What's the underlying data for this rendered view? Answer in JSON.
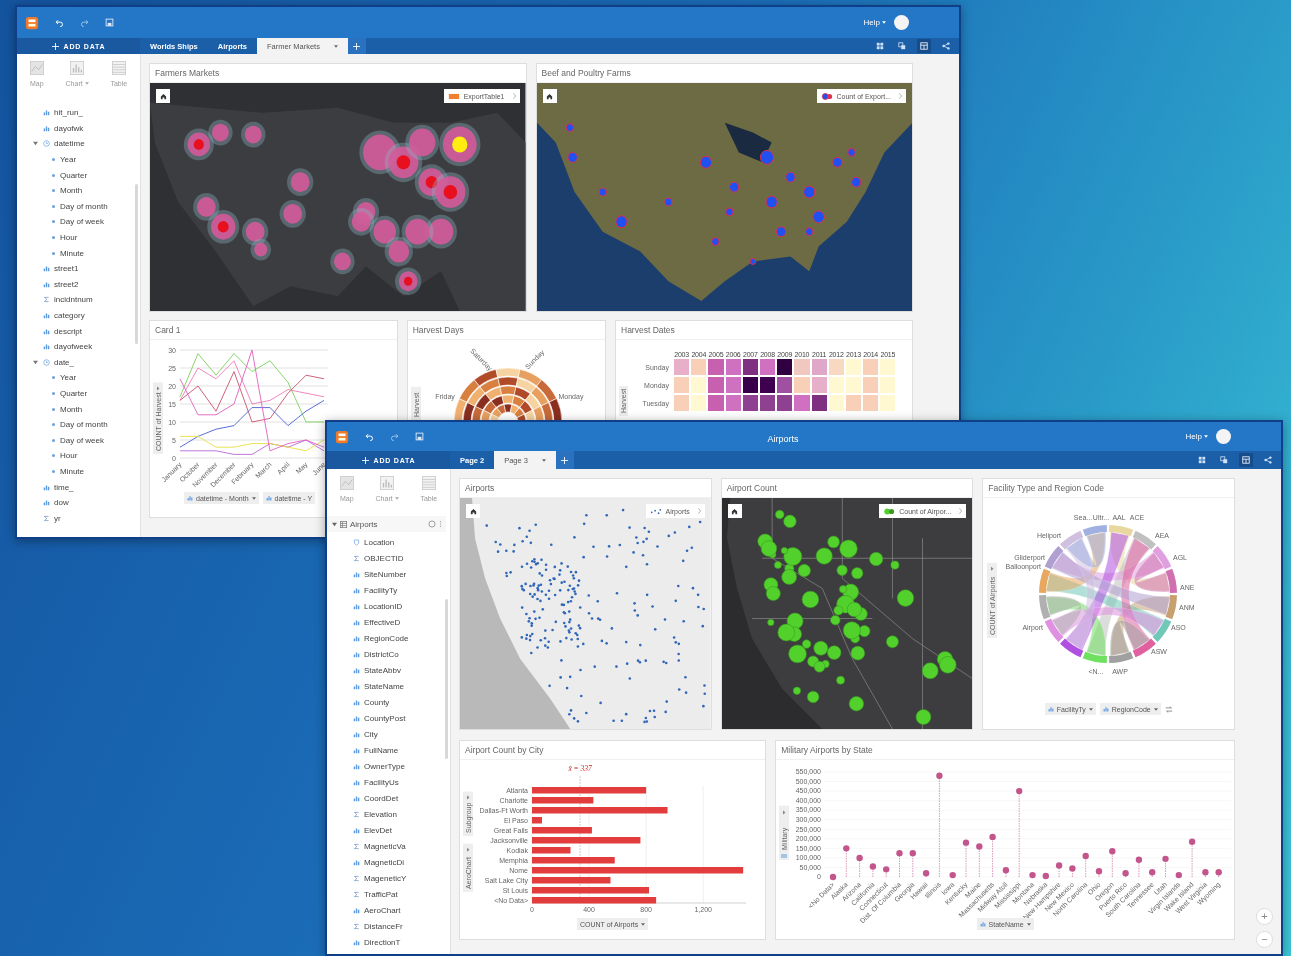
{
  "windows": [
    {
      "help": "Help",
      "add_data": "ADD DATA",
      "tabs": [
        {
          "label": "Worlds Ships",
          "selected": false
        },
        {
          "label": "Airports",
          "selected": false
        },
        {
          "label": "Farmer Markets",
          "selected": true
        }
      ],
      "create": [
        {
          "label": "Map",
          "kind": "map",
          "menu": false
        },
        {
          "label": "Chart",
          "kind": "chart",
          "menu": true
        },
        {
          "label": "Table",
          "kind": "table",
          "menu": false
        }
      ],
      "fields": [
        {
          "name": "hit_run_",
          "kind": "string"
        },
        {
          "name": "dayofwk",
          "kind": "string"
        },
        {
          "name": "datetime",
          "kind": "date",
          "expanded": true,
          "children": [
            {
              "name": "Year"
            },
            {
              "name": "Quarter"
            },
            {
              "name": "Month"
            },
            {
              "name": "Day of month"
            },
            {
              "name": "Day of week"
            },
            {
              "name": "Hour"
            },
            {
              "name": "Minute"
            }
          ]
        },
        {
          "name": "street1",
          "kind": "string"
        },
        {
          "name": "street2",
          "kind": "string"
        },
        {
          "name": "incidntnum",
          "kind": "number"
        },
        {
          "name": "category",
          "kind": "string"
        },
        {
          "name": "descript",
          "kind": "string"
        },
        {
          "name": "dayofweek",
          "kind": "string"
        },
        {
          "name": "date_",
          "kind": "date",
          "expanded": true,
          "children": [
            {
              "name": "Year"
            },
            {
              "name": "Quarter"
            },
            {
              "name": "Month"
            },
            {
              "name": "Day of month"
            },
            {
              "name": "Day of week"
            },
            {
              "name": "Hour"
            },
            {
              "name": "Minute"
            }
          ]
        },
        {
          "name": "time_",
          "kind": "string"
        },
        {
          "name": "dow",
          "kind": "string"
        },
        {
          "name": "yr",
          "kind": "number"
        }
      ],
      "card_rows": [
        [
          {
            "kind": "heat",
            "title": "Farmers Markets",
            "legend": "ExportTable1"
          },
          {
            "kind": "satellite",
            "title": "Beef and Poultry Farms",
            "legend": "Count of Export..."
          }
        ],
        [
          {
            "kind": "line",
            "title": "Card 1",
            "x_buttons": [
              {
                "label": "datetime - Month",
                "menu": true
              },
              {
                "label": "datetime - Y",
                "menu": false
              }
            ],
            "chart_data": {
              "type": "line",
              "ylabel": "COUNT of Harvest",
              "categories": [
                "January",
                "October",
                "November",
                "December",
                "February",
                "March",
                "April",
                "May",
                "June"
              ],
              "ylim": [
                0,
                30
              ],
              "yticks": [
                0,
                5,
                10,
                15,
                20,
                25,
                30
              ],
              "grid": true,
              "series": [
                {
                  "color": "#7ccf5a",
                  "values": [
                    17,
                    29,
                    23,
                    29,
                    24,
                    27,
                    21,
                    10,
                    10
                  ]
                },
                {
                  "color": "#f07ab8",
                  "values": [
                    16,
                    25,
                    22,
                    27,
                    15,
                    16,
                    19,
                    18,
                    17
                  ]
                },
                {
                  "color": "#c8506a",
                  "values": [
                    16,
                    20,
                    13,
                    24,
                    10,
                    11,
                    18,
                    23,
                    22
                  ]
                },
                {
                  "color": "#4a5fcf",
                  "values": [
                    3,
                    6,
                    8,
                    9,
                    14,
                    14,
                    9,
                    13,
                    16
                  ]
                },
                {
                  "color": "#b86ad8",
                  "values": [
                    2,
                    2,
                    2,
                    1,
                    1,
                    4,
                    3,
                    5,
                    2
                  ]
                },
                {
                  "color": "#e8e040",
                  "values": [
                    6,
                    6,
                    3,
                    3,
                    4,
                    4,
                    3,
                    2,
                    5
                  ]
                },
                {
                  "color": "#e060c0",
                  "values": [
                    22,
                    12,
                    12,
                    15,
                    30,
                    2,
                    4,
                    5,
                    3
                  ]
                }
              ]
            }
          },
          {
            "kind": "radial",
            "title": "Harvest Days",
            "axis": "Harvest",
            "labels": [
              "Saturday",
              "Sunday",
              "Friday",
              "Monday"
            ]
          },
          {
            "kind": "heatmap",
            "title": "Harvest Dates",
            "axis": "Harvest",
            "columns": [
              "2003",
              "2004",
              "2005",
              "2006",
              "2007",
              "2008",
              "2009",
              "2010",
              "2011",
              "2012",
              "2013",
              "2014",
              "2015"
            ],
            "rows": [
              {
                "label": "Sunday",
                "cells": [
                  {
                    "color": "#e8b0c8"
                  },
                  {
                    "color": "#f8d0b8"
                  },
                  {
                    "color": "#c860b0"
                  },
                  {
                    "color": "#d070c0"
                  },
                  {
                    "color": "#803080"
                  },
                  {
                    "color": "#d070c0"
                  },
                  {
                    "color": "#300040"
                  },
                  {
                    "color": "#f0c8c0"
                  },
                  {
                    "color": "#e0a8c8"
                  },
                  {
                    "color": "#f8d8c0"
                  },
                  {
                    "color": "#fff8d0"
                  },
                  {
                    "color": "#f8d0b8"
                  },
                  {
                    "color": "#fff8d0"
                  }
                ]
              },
              {
                "label": "Monday",
                "cells": [
                  {
                    "color": "#f8d0b8"
                  },
                  {
                    "color": "#fff8d0"
                  },
                  {
                    "color": "#c860b0"
                  },
                  {
                    "color": "#d070c0"
                  },
                  {
                    "color": "#380048"
                  },
                  {
                    "color": "#400050"
                  },
                  {
                    "color": "#a050a0"
                  },
                  {
                    "color": "#f8d0b8"
                  },
                  {
                    "color": "#e8b0c8"
                  },
                  {
                    "color": "#fff8d0"
                  },
                  {
                    "color": "#fff8d0"
                  },
                  {
                    "color": "#f8d0b8"
                  },
                  {
                    "color": "#fff8d0"
                  }
                ]
              },
              {
                "label": "Tuesday",
                "cells": [
                  {
                    "color": "#f8d0b8"
                  },
                  {
                    "color": "#fff8d0"
                  },
                  {
                    "color": "#c860b0"
                  },
                  {
                    "color": "#d070c0"
                  },
                  {
                    "color": "#904090"
                  },
                  {
                    "color": "#904090"
                  },
                  {
                    "color": "#904090"
                  },
                  {
                    "color": "#d070c0"
                  },
                  {
                    "color": "#803080"
                  },
                  {
                    "color": "#fff8d0"
                  },
                  {
                    "color": "#f8d0b8"
                  },
                  {
                    "color": "#f8d0b8"
                  },
                  {
                    "color": "#fff8d0"
                  }
                ]
              }
            ]
          }
        ]
      ]
    },
    {
      "title": "Airports",
      "help": "Help",
      "add_data": "ADD DATA",
      "tabs": [
        {
          "label": "Page 2",
          "selected": false
        },
        {
          "label": "Page 3",
          "selected": true
        }
      ],
      "create": [
        {
          "label": "Map",
          "kind": "map",
          "menu": false
        },
        {
          "label": "Chart",
          "kind": "chart",
          "menu": true
        },
        {
          "label": "Table",
          "kind": "table",
          "menu": false
        }
      ],
      "dataset": {
        "name": "Airports",
        "expanded": true
      },
      "fields": [
        {
          "name": "Location",
          "kind": "location"
        },
        {
          "name": "OBJECTID",
          "kind": "number"
        },
        {
          "name": "SiteNumber",
          "kind": "string"
        },
        {
          "name": "FacilityTy",
          "kind": "string"
        },
        {
          "name": "LocationID",
          "kind": "string"
        },
        {
          "name": "EffectiveD",
          "kind": "string"
        },
        {
          "name": "RegionCode",
          "kind": "string"
        },
        {
          "name": "DistrictCo",
          "kind": "string"
        },
        {
          "name": "StateAbbv",
          "kind": "string"
        },
        {
          "name": "StateName",
          "kind": "string"
        },
        {
          "name": "County",
          "kind": "string"
        },
        {
          "name": "CountyPost",
          "kind": "string"
        },
        {
          "name": "City",
          "kind": "string"
        },
        {
          "name": "FullName",
          "kind": "string"
        },
        {
          "name": "OwnerType",
          "kind": "string"
        },
        {
          "name": "FacilityUs",
          "kind": "string"
        },
        {
          "name": "CoordDet",
          "kind": "string"
        },
        {
          "name": "Elevation",
          "kind": "number"
        },
        {
          "name": "ElevDet",
          "kind": "string"
        },
        {
          "name": "MagneticVa",
          "kind": "number"
        },
        {
          "name": "MagneticDi",
          "kind": "string"
        },
        {
          "name": "MageneticY",
          "kind": "number"
        },
        {
          "name": "TrafficPat",
          "kind": "number"
        },
        {
          "name": "AeroChart",
          "kind": "string"
        },
        {
          "name": "DistanceFr",
          "kind": "number"
        },
        {
          "name": "DirectionT",
          "kind": "string"
        }
      ],
      "card_rows": [
        [
          {
            "kind": "dots",
            "title": "Airports",
            "legend": "Airports"
          },
          {
            "kind": "bubbles",
            "title": "Airport Count",
            "legend": "Count of Airpor..."
          },
          {
            "kind": "chord",
            "title": "Facility Type and Region Code",
            "axis": "COUNT of Airports",
            "labels": [
              "Sea...",
              "Ultr...",
              "AAL",
              "ACE",
              "Heliport",
              "AEA",
              "Gliderport",
              "AGL",
              "Balloonport",
              "ANE",
              "ANM",
              "Airport",
              "ASO",
              "ASW",
              "<N...",
              "AWP"
            ],
            "buttons": [
              "FacilityTy",
              "RegionCode"
            ]
          }
        ],
        [
          {
            "kind": "bar",
            "title": "Airport Count by City",
            "axis_buttons": [
              "Subgroup",
              "AeroChart"
            ],
            "chart_data": {
              "type": "bar",
              "orientation": "horizontal",
              "xlabel": "COUNT of Airports",
              "categories": [
                "Atlanta",
                "Charlotte",
                "Dallas-Ft Worth",
                "El Paso",
                "Great Falls",
                "Jacksonville",
                "Kodiak",
                "Memphia",
                "Nome",
                "Salt Lake City",
                "St Louis",
                "<No Data>"
              ],
              "series": [
                {
                  "color": "#e23c3c",
                  "values": [
                    800,
                    430,
                    950,
                    70,
                    420,
                    760,
                    270,
                    580,
                    1480,
                    550,
                    820,
                    870
                  ]
                }
              ],
              "xlim": [
                0,
                1500
              ],
              "xticks": [
                0,
                400,
                800,
                {
                  "value": 1200,
                  "label": "1,200"
                }
              ],
              "grid": true,
              "ref_lines": [
                {
                  "axis": "x",
                  "value": 337,
                  "label": "x̄ = 337"
                }
              ]
            }
          },
          {
            "kind": "lollipop",
            "title": "Military Airports by State",
            "chart_data": {
              "type": "scatter",
              "ylabel": "Military",
              "xlabel": "StateName",
              "grid": true,
              "categories": [
                "<No Data>",
                "Alaska",
                "Arizona",
                "California",
                "Connecticut",
                "Dist. Of Columbia",
                "Georgia",
                "Hawaii",
                "Illinois",
                "Iowa",
                "Kentucky",
                "Maine",
                "Massachusetts",
                "Midway Atoll",
                "Mississippi",
                "Montana",
                "Nebraska",
                "New Hampshire",
                "New Mexico",
                "North Carolina",
                "Ohio",
                "Oregon",
                "Puerto Rico",
                "South Carolina",
                "Tennessee",
                "Utah",
                "Virgin Islands",
                "Wake Island",
                "West Virginia",
                "Wyoming"
              ],
              "series": [
                {
                  "color": "#c2568c",
                  "values": [
                    0,
                    150000,
                    100000,
                    55000,
                    40000,
                    125000,
                    125000,
                    20000,
                    530000,
                    10000,
                    180000,
                    160000,
                    210000,
                    35000,
                    450000,
                    10000,
                    5000,
                    60000,
                    45000,
                    110000,
                    30000,
                    135000,
                    20000,
                    90000,
                    25000,
                    95000,
                    10000,
                    185000,
                    25000,
                    25000
                  ]
                }
              ],
              "ylim": [
                0,
                550000
              ],
              "yticks": [
                {
                  "value": 0,
                  "label": "0"
                },
                {
                  "value": 50000,
                  "label": "50,000"
                },
                {
                  "value": 100000,
                  "label": "100,000"
                },
                {
                  "value": 150000,
                  "label": "150,000"
                },
                {
                  "value": 200000,
                  "label": "200,000"
                },
                {
                  "value": 250000,
                  "label": "250,000"
                },
                {
                  "value": 300000,
                  "label": "300,000"
                },
                {
                  "value": 350000,
                  "label": "350,000"
                },
                {
                  "value": 400000,
                  "label": "400,000"
                },
                {
                  "value": 450000,
                  "label": "450,000"
                },
                {
                  "value": 500000,
                  "label": "500,000"
                },
                {
                  "value": 550000,
                  "label": "550,000"
                }
              ]
            }
          }
        ]
      ],
      "zoom_buttons": [
        "+",
        "−"
      ]
    }
  ]
}
